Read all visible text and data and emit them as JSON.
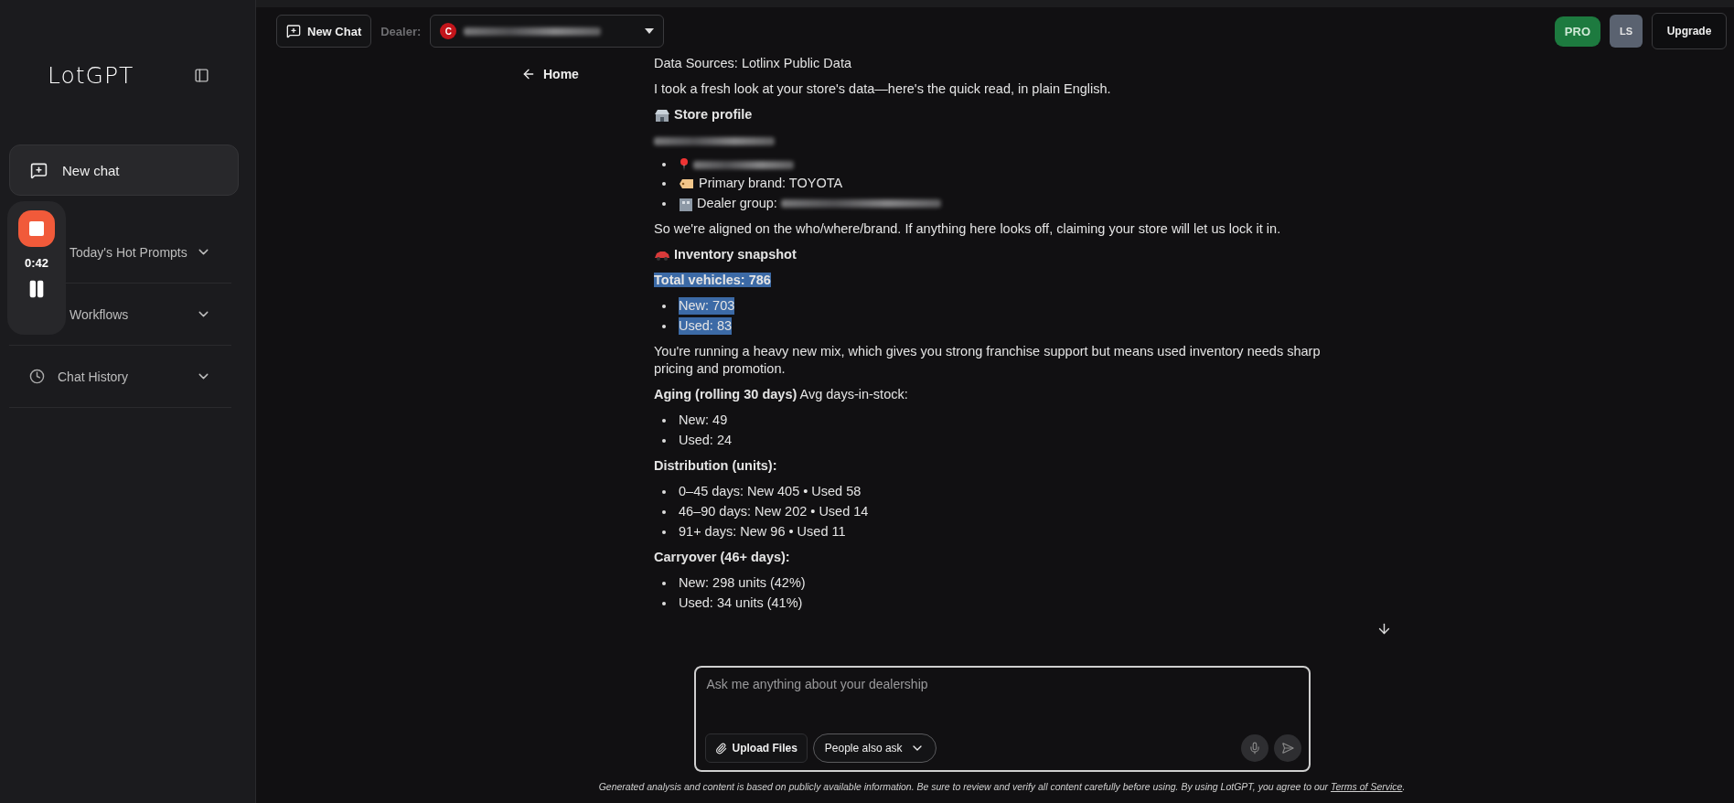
{
  "sidebar": {
    "logo": "LotGPT",
    "new_chat": "New chat",
    "sections": [
      {
        "label": "Today's Hot Prompts",
        "expanded": false
      },
      {
        "label": "Workflows",
        "expanded": false
      },
      {
        "label": "Chat History",
        "expanded": false
      }
    ]
  },
  "recorder": {
    "time": "0:42"
  },
  "topbar": {
    "new_chat": "New Chat",
    "dealer_label": "Dealer:",
    "dealer_badge": "C",
    "plan": "PRO",
    "avatar": "LS",
    "upgrade": "Upgrade"
  },
  "home": "Home",
  "message": [
    {
      "kind": "para",
      "text": "Data Sources: Lotlinx Public Data"
    },
    {
      "kind": "para",
      "text": "I took a fresh look at your store's data—here's the quick read, in plain English."
    },
    {
      "kind": "heading",
      "text": "Store profile"
    },
    {
      "kind": "redacted"
    },
    {
      "kind": "list",
      "items": [
        {
          "kind": "location",
          "redacted": true
        },
        {
          "kind": "brand",
          "text": "Primary brand: TOYOTA"
        },
        {
          "kind": "group",
          "text": "Dealer group:",
          "redacted": true
        }
      ]
    },
    {
      "kind": "para",
      "text": "So we're aligned on the who/where/brand. If anything here looks off, claiming your store will let us lock it in."
    },
    {
      "kind": "heading",
      "text": "Inventory snapshot"
    },
    {
      "kind": "para",
      "text": "Total vehicles: 786",
      "highlighted": true
    },
    {
      "kind": "list",
      "items": [
        {
          "text": "New: 703",
          "highlighted": true
        },
        {
          "text": "Used: 83",
          "highlighted": true
        }
      ]
    },
    {
      "kind": "para",
      "text": "You're running a heavy new mix, which gives you strong franchise support but means used inventory needs sharp pricing and promotion."
    },
    {
      "kind": "para",
      "text": "**Aging (rolling 30 days)** Avg days-in-stock:"
    },
    {
      "kind": "list",
      "items": [
        {
          "text": "New: 49"
        },
        {
          "text": "Used: 24"
        }
      ]
    },
    {
      "kind": "subhead",
      "text": "Distribution (units):"
    },
    {
      "kind": "list",
      "items": [
        {
          "text": "0–45 days: New 405 • Used 58"
        },
        {
          "text": "46–90 days: New 202 • Used 14"
        },
        {
          "text": "91+ days: New 96 • Used 11"
        }
      ]
    },
    {
      "kind": "subhead",
      "text": "Carryover (46+ days):"
    },
    {
      "kind": "list",
      "items": [
        {
          "text": "New: 298 units (42%)"
        },
        {
          "text": "Used: 34 units (41%)"
        }
      ]
    }
  ],
  "composer": {
    "placeholder": "Ask me anything about your dealership",
    "upload": "Upload Files",
    "people_ask": "People also ask"
  },
  "footer": {
    "text": "Generated analysis and content is based on publicly available information. Be sure to review and verify all content carefully before using. By using LotGPT, you agree to our",
    "link": "Terms of Service",
    "end": "."
  }
}
